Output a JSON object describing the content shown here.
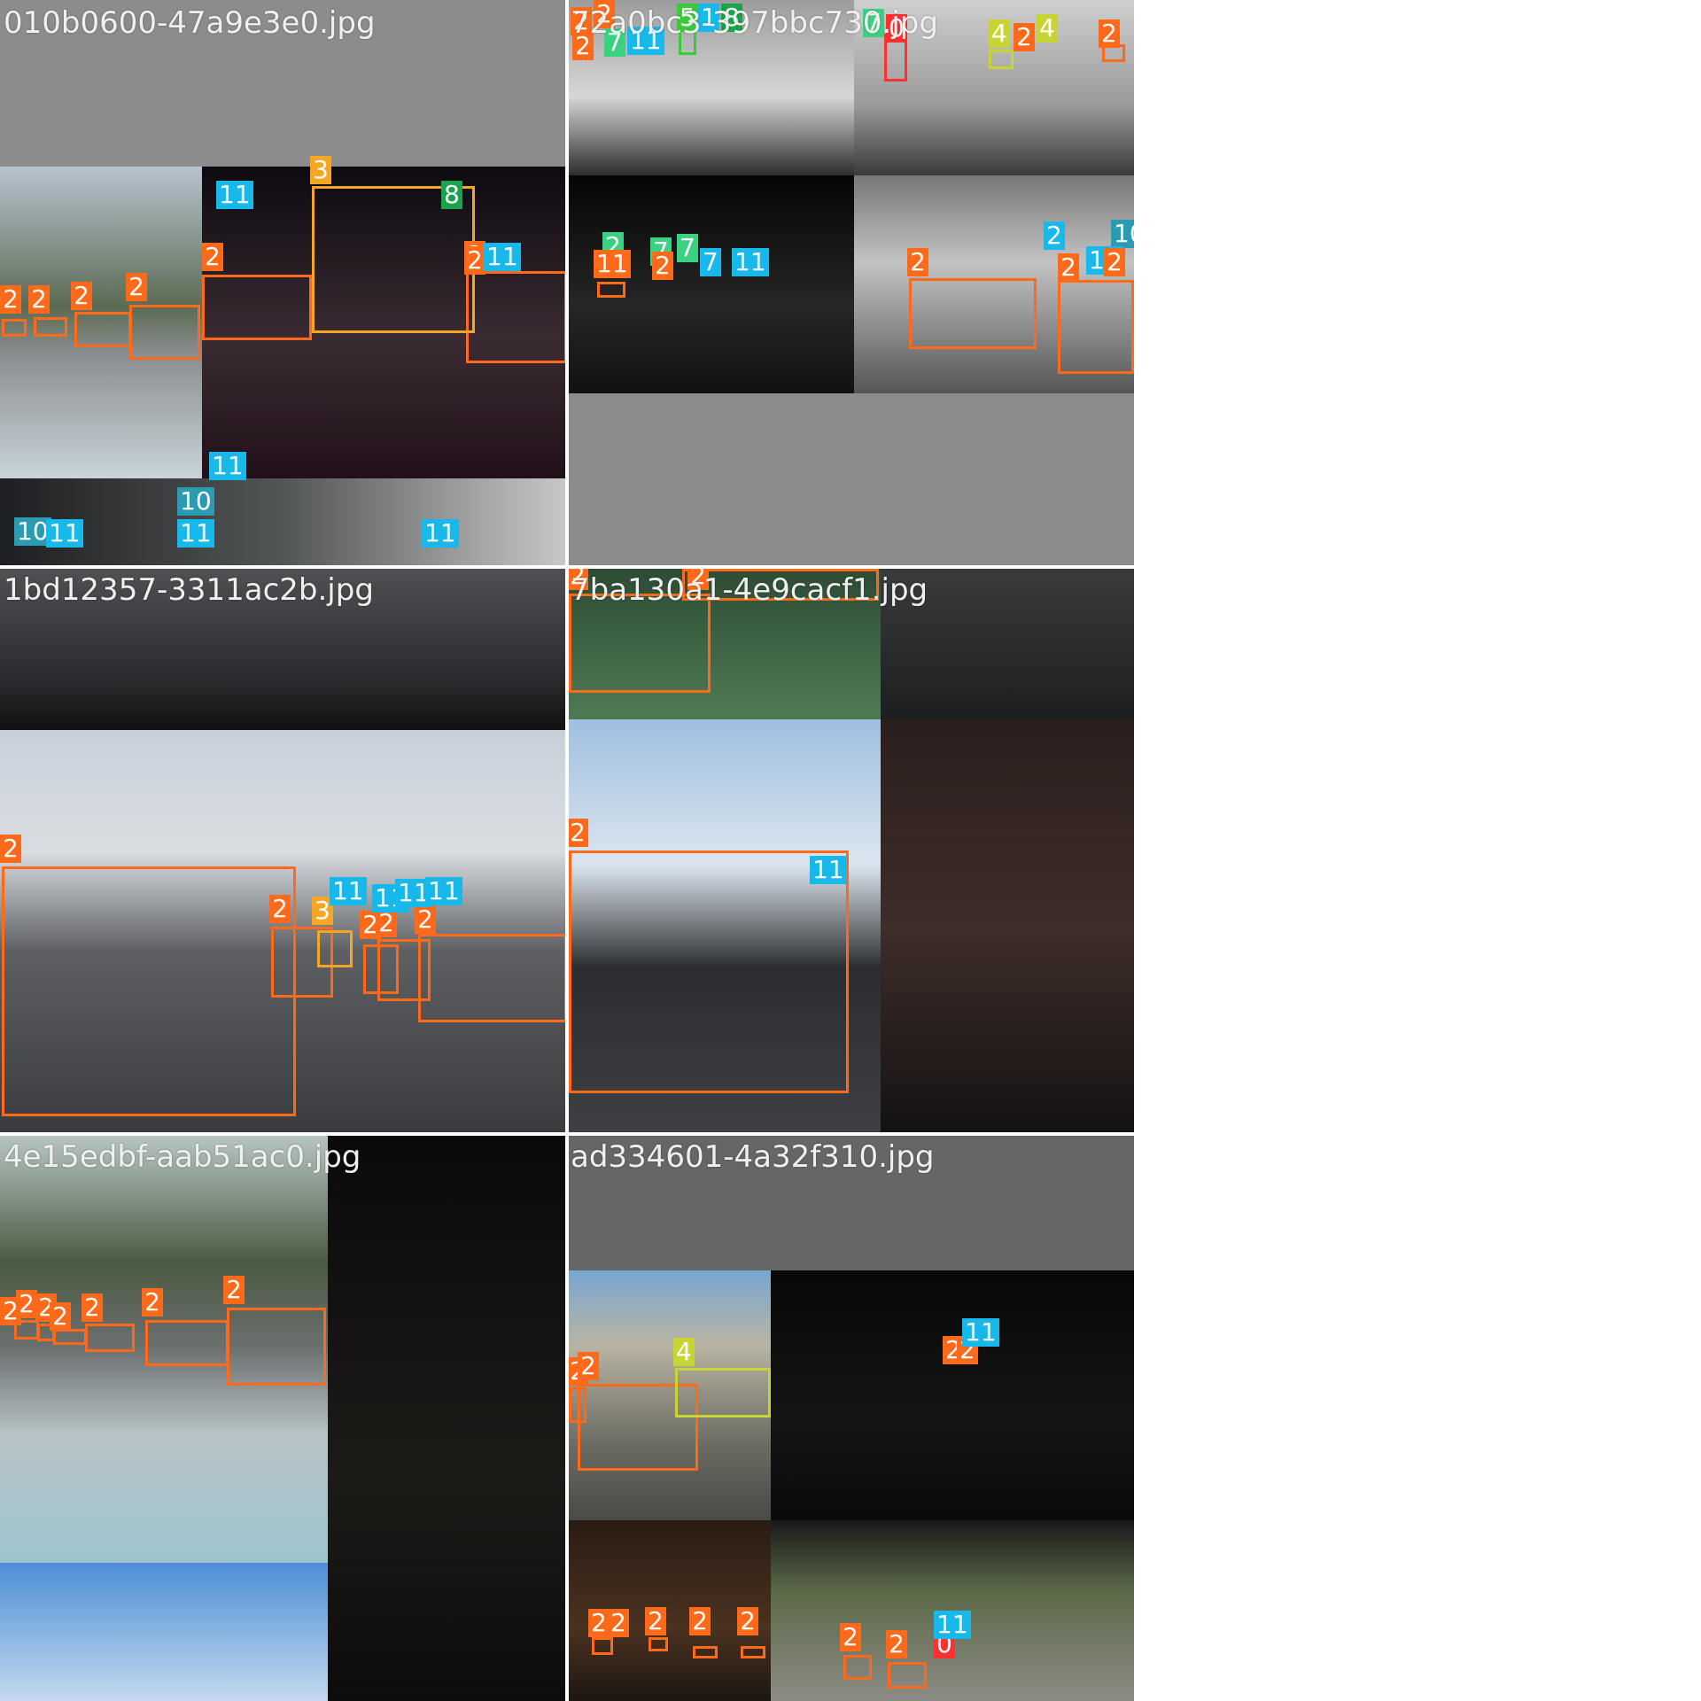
{
  "colors": {
    "c0": "#ff3030",
    "c2": "#ff6a1a",
    "c3": "#f5a623",
    "c4": "#c8d334",
    "c5": "#3acb3a",
    "c7": "#3ad181",
    "c8": "#1aa34a",
    "c10": "#2a9bb0",
    "c11": "#18b9ea"
  },
  "tiles": [
    {
      "filename": "010b0600-47a9e3e0.jpg",
      "labels": [
        "2",
        "2",
        "2",
        "2",
        "2",
        "2",
        "3",
        "8",
        "11",
        "11",
        "11",
        "10",
        "10",
        "11",
        "11",
        "2",
        "11"
      ]
    },
    {
      "filename": "72a0bc3-397bbc730.jpg",
      "labels": [
        "2",
        "2",
        "2",
        "7",
        "11",
        "5",
        "1",
        "8",
        "7",
        "0",
        "4",
        "2",
        "4",
        "2",
        "2",
        "7",
        "7",
        "7",
        "11",
        "11",
        "2",
        "2",
        "2",
        "2",
        "11",
        "10",
        "11",
        "2"
      ]
    },
    {
      "filename": "1bd12357-3311ac2b.jpg",
      "labels": [
        "2",
        "2",
        "3",
        "2",
        "2",
        "2",
        "11",
        "11",
        "11",
        "11"
      ]
    },
    {
      "filename": "7ba130a1-4e9cacf1.jpg",
      "labels": [
        "2",
        "2",
        "2",
        "11"
      ]
    },
    {
      "filename": "4e15edbf-aab51ac0.jpg",
      "labels": [
        "2",
        "2",
        "2",
        "2",
        "2",
        "2",
        "2"
      ]
    },
    {
      "filename": "ad334601-4a32f310.jpg",
      "labels": [
        "2",
        "2",
        "4",
        "2",
        "2",
        "11",
        "2",
        "2",
        "2",
        "2",
        "2",
        "2",
        "2",
        "0",
        "11"
      ]
    }
  ]
}
